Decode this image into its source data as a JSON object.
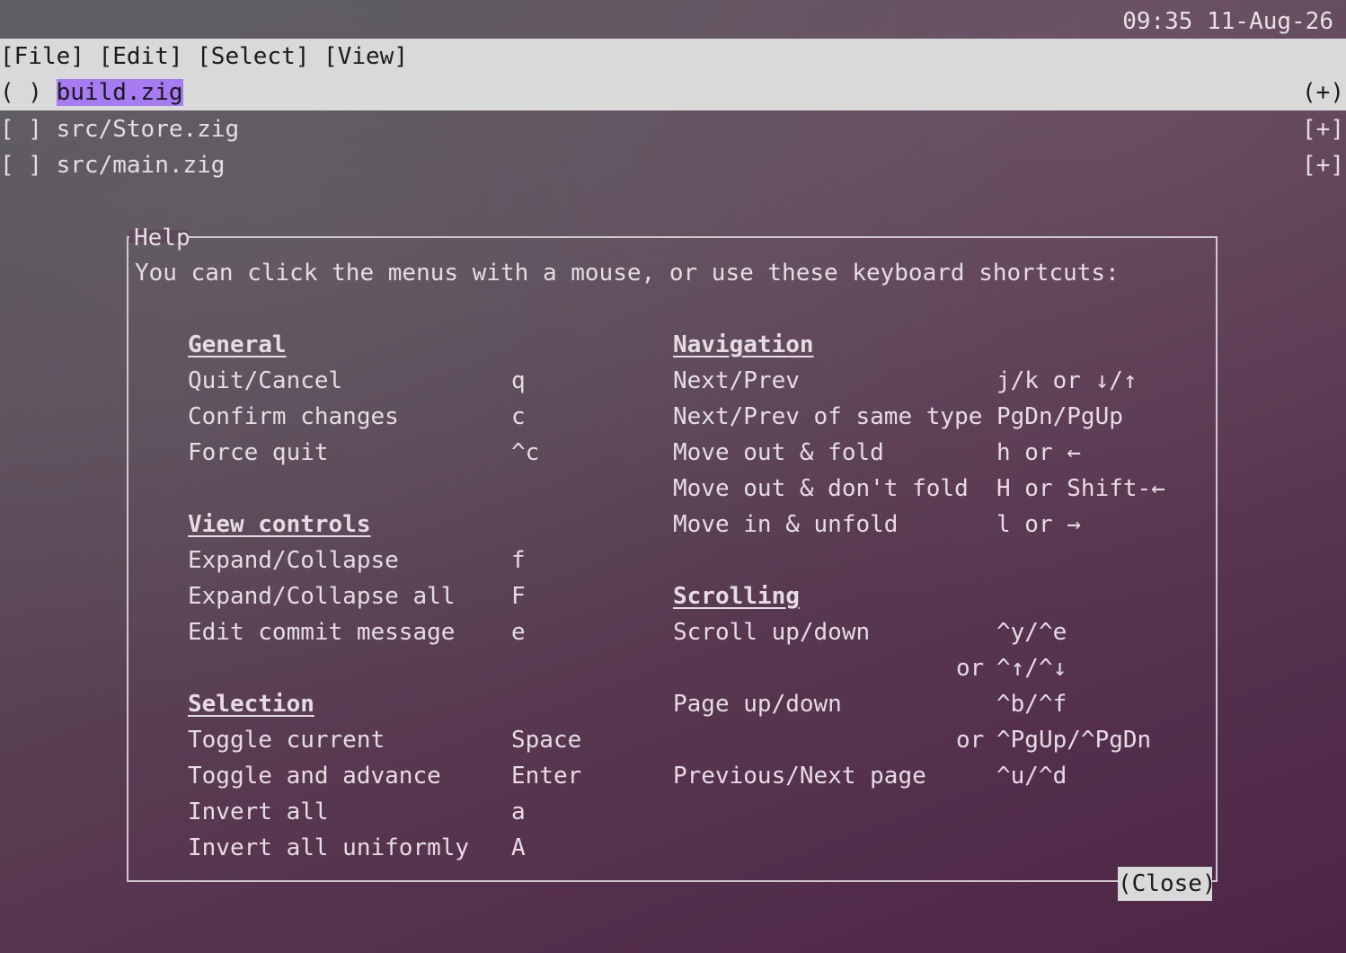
{
  "clock": "09:35 11-Aug-26",
  "menu": [
    "[File]",
    "[Edit]",
    "[Select]",
    "[View]"
  ],
  "files": [
    {
      "check": "( )",
      "name": "build.zig",
      "expand": "(+)"
    },
    {
      "check": "[ ]",
      "name": "src/Store.zig",
      "expand": "[+]"
    },
    {
      "check": "[ ]",
      "name": "src/main.zig",
      "expand": "[+]"
    }
  ],
  "help": {
    "title": "Help",
    "intro": "You can click the menus with a mouse, or use these keyboard shortcuts:",
    "close": "(Close)",
    "general": {
      "heading": "General",
      "items": [
        {
          "label": "Quit/Cancel",
          "key": "q"
        },
        {
          "label": "Confirm changes",
          "key": "c"
        },
        {
          "label": "Force quit",
          "key": "^c"
        }
      ]
    },
    "view_controls": {
      "heading": "View controls",
      "items": [
        {
          "label": "Expand/Collapse",
          "key": "f"
        },
        {
          "label": "Expand/Collapse all",
          "key": "F"
        },
        {
          "label": "Edit commit message",
          "key": "e"
        }
      ]
    },
    "selection": {
      "heading": "Selection",
      "items": [
        {
          "label": "Toggle current",
          "key": "Space"
        },
        {
          "label": "Toggle and advance",
          "key": "Enter"
        },
        {
          "label": "Invert all",
          "key": "a"
        },
        {
          "label": "Invert all uniformly",
          "key": "A"
        }
      ]
    },
    "navigation": {
      "heading": "Navigation",
      "items": [
        {
          "label": "Next/Prev",
          "key": "j/k or ↓/↑"
        },
        {
          "label": "Next/Prev of same type",
          "key": "PgDn/PgUp"
        },
        {
          "label": "Move out & fold",
          "key": "h or ←"
        },
        {
          "label": "Move out & don't fold",
          "key": "H or Shift-←"
        },
        {
          "label": "Move in & unfold",
          "key": "l or →"
        }
      ]
    },
    "scrolling": {
      "heading": "Scrolling",
      "items": [
        {
          "label": "Scroll up/down",
          "key": "^y/^e"
        },
        {
          "label": "",
          "or": "or",
          "key": "^↑/^↓"
        },
        {
          "label": "Page up/down",
          "key": "^b/^f"
        },
        {
          "label": "",
          "or": "or",
          "key": "^PgUp/^PgDn"
        },
        {
          "label": "Previous/Next page",
          "key": "^u/^d"
        }
      ]
    }
  }
}
